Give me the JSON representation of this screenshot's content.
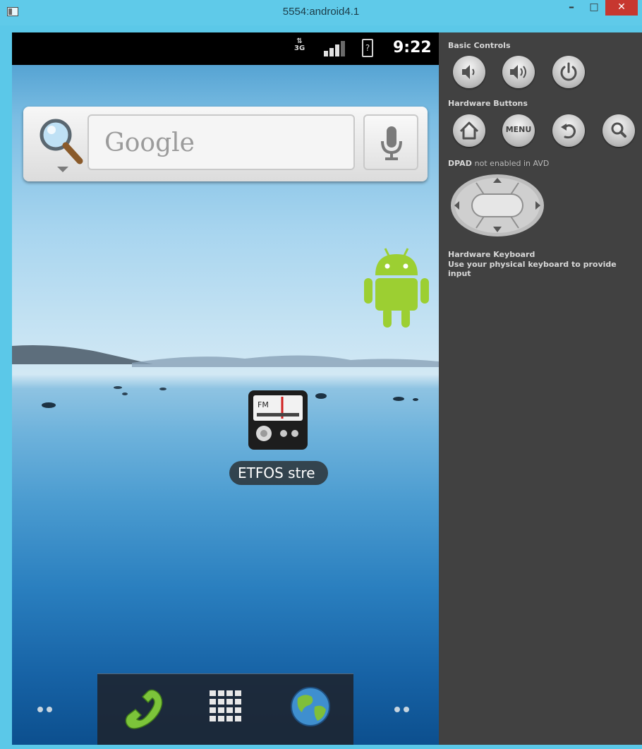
{
  "window": {
    "title": "5554:android4.1",
    "minimize_glyph": "–",
    "maximize_glyph": "□",
    "close_glyph": "✕"
  },
  "status_bar": {
    "network_type": "3G",
    "time": "9:22",
    "battery_glyph": "?"
  },
  "search_widget": {
    "placeholder": "Google"
  },
  "home": {
    "app_label": "ETFOS stre"
  },
  "controls": {
    "basic_heading": "Basic Controls",
    "hardware_heading": "Hardware Buttons",
    "menu_button_label": "MENU",
    "dpad_heading": "DPAD",
    "dpad_note": "not enabled in AVD",
    "keyboard_heading": "Hardware Keyboard",
    "keyboard_note": "Use your physical keyboard to provide input"
  },
  "colors": {
    "titlebar": "#5fcae9",
    "close_button": "#c7372f",
    "panel": "#414141",
    "android_green": "#9ccf32"
  }
}
